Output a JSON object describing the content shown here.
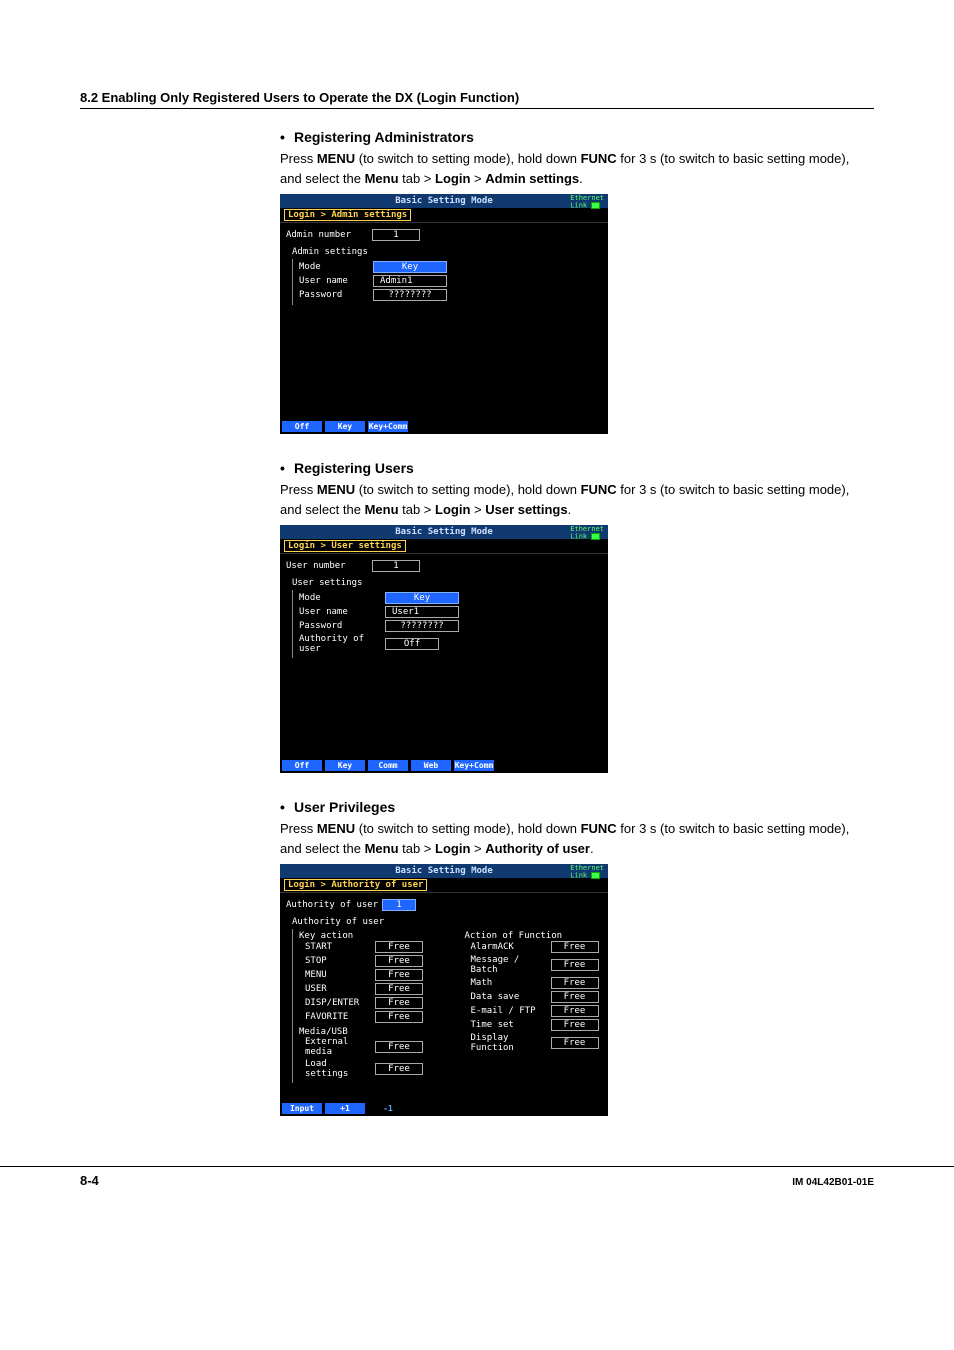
{
  "heading": "8.2  Enabling Only Registered Users to Operate the DX (Login Function)",
  "footer": {
    "page": "8-4",
    "doc": "IM 04L42B01-01E"
  },
  "common": {
    "ethernet": "Ethernet",
    "link": "Link",
    "screenTitle": "Basic Setting Mode"
  },
  "admins": {
    "title": "Registering Administrators",
    "text1": {
      "pre": "Press ",
      "menu": "MENU",
      "mid": " (to switch to setting mode), hold down ",
      "func": "FUNC",
      "post": " for 3 s (to switch to basic setting mode), and select the ",
      "mtab": "Menu",
      "gt1": " tab > ",
      "lgn": "Login",
      "gt2": " > ",
      "last": "Admin settings",
      "dot": "."
    },
    "breadcrumb": "Login > Admin settings",
    "fields": {
      "numLabel": "Admin number",
      "numVal": "1",
      "groupTitle": "Admin settings",
      "modeLabel": "Mode",
      "modeVal": "Key",
      "userLabel": "User name",
      "userVal": "Admin1",
      "pwLabel": "Password",
      "pwVal": "????????"
    },
    "buttons": [
      "Off",
      "Key",
      "Key+Comm"
    ]
  },
  "users": {
    "title": "Registering Users",
    "text1": {
      "pre": "Press ",
      "menu": "MENU",
      "mid": " (to switch to setting mode), hold down ",
      "func": "FUNC",
      "post": " for 3 s (to switch to basic setting mode), and select the ",
      "mtab": "Menu",
      "gt1": " tab > ",
      "lgn": "Login",
      "gt2": " > ",
      "last": "User settings",
      "dot": "."
    },
    "breadcrumb": "Login > User settings",
    "fields": {
      "numLabel": "User number",
      "numVal": "1",
      "groupTitle": "User settings",
      "modeLabel": "Mode",
      "modeVal": "Key",
      "userLabel": "User name",
      "userVal": "User1",
      "pwLabel": "Password",
      "pwVal": "????????",
      "authLabel": "Authority of user",
      "authVal": "Off"
    },
    "buttons": [
      "Off",
      "Key",
      "Comm",
      "Web",
      "Key+Comm"
    ]
  },
  "priv": {
    "title": "User Privileges",
    "text1": {
      "pre": "Press ",
      "menu": "MENU",
      "mid": " (to switch to setting mode), hold down ",
      "func": "FUNC",
      "post": " for 3 s (to switch to basic setting mode), and select the ",
      "mtab": "Menu",
      "gt1": " tab > ",
      "lgn": "Login",
      "gt2": " > ",
      "last": "Authority of user",
      "dot": "."
    },
    "breadcrumb": "Login > Authority of user",
    "top": {
      "label": "Authority of user",
      "val": "1",
      "group": "Authority of user"
    },
    "left": {
      "keyActionHead": "Key action",
      "items": [
        {
          "l": "START",
          "v": "Free"
        },
        {
          "l": "STOP",
          "v": "Free"
        },
        {
          "l": "MENU",
          "v": "Free"
        },
        {
          "l": "USER",
          "v": "Free"
        },
        {
          "l": "DISP/ENTER",
          "v": "Free"
        },
        {
          "l": "FAVORITE",
          "v": "Free"
        }
      ],
      "mediaHead": "Media/USB",
      "mediaItems": [
        {
          "l": "External media",
          "v": "Free"
        },
        {
          "l": "Load settings",
          "v": "Free"
        }
      ]
    },
    "right": {
      "head": "Action of Function",
      "items": [
        {
          "l": "AlarmACK",
          "v": "Free"
        },
        {
          "l": "Message / Batch",
          "v": "Free"
        },
        {
          "l": "Math",
          "v": "Free"
        },
        {
          "l": "Data save",
          "v": "Free"
        },
        {
          "l": "E-mail / FTP",
          "v": "Free"
        },
        {
          "l": "Time set",
          "v": "Free"
        },
        {
          "l": "Display Function",
          "v": "Free"
        }
      ]
    },
    "buttons": [
      "Input",
      "+1",
      "-1"
    ]
  }
}
